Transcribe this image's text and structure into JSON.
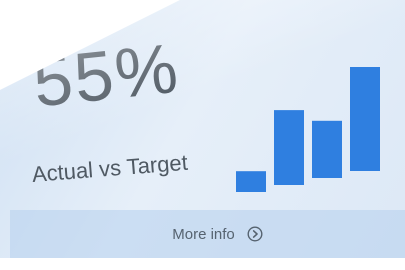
{
  "widget": {
    "value": "55%",
    "subtitle": "Actual vs Target",
    "more_info_label": "More info",
    "more_info_icon": "chevron-circle-right-icon",
    "bar_color": "#2f7fe0",
    "bar_levels": [
      0.2,
      0.72,
      0.55,
      1.0
    ]
  }
}
